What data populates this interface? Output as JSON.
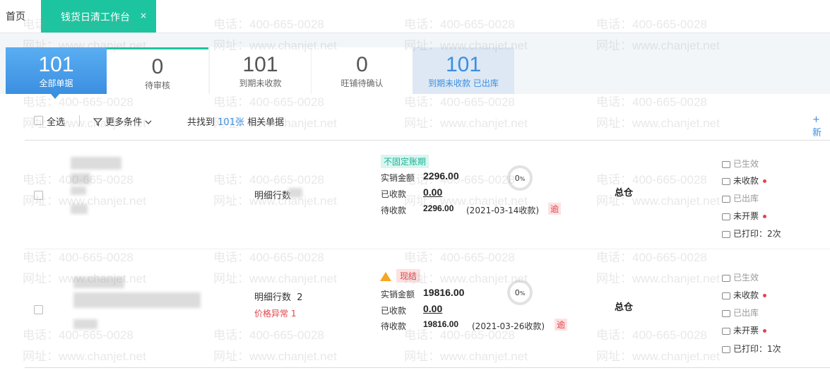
{
  "tabs": {
    "home": "首页",
    "active": "钱货日清工作台",
    "close": "×"
  },
  "stats": [
    {
      "num": "101",
      "label": "全部单据"
    },
    {
      "num": "0",
      "label": "待审核"
    },
    {
      "num": "101",
      "label": "到期未收款"
    },
    {
      "num": "0",
      "label": "旺铺待确认"
    },
    {
      "num": "101",
      "label": "到期未收款 已出库"
    }
  ],
  "toolbar": {
    "select_all": "全选",
    "more_conditions": "更多条件",
    "found_prefix": "共找到",
    "found_count": "101张",
    "found_suffix": "相关单据",
    "new_partial": "+ 新"
  },
  "watermark": {
    "phone": "电话：400-665-0028",
    "site": "网址：www.chanjet.net"
  },
  "rows": [
    {
      "detail": "明细行数",
      "detail_count": "",
      "price_abnormal": "",
      "tag": "不固定账期",
      "sales_label": "实销金额",
      "sales_value": "2296.00",
      "received_label": "已收款",
      "received_value": "0.00",
      "pending_label": "待收款",
      "pending_value": "2296.00",
      "due_date": "(2021-03-14收款)",
      "overdue": "逾",
      "progress_pct": "0",
      "warehouse": "总仓",
      "status": [
        "已生效",
        "未收款",
        "已出库",
        "未开票",
        "已打印：2次"
      ]
    },
    {
      "detail": "明细行数",
      "detail_count": "2",
      "price_abnormal": "价格异常  1",
      "tag": "现结",
      "sales_label": "实销金额",
      "sales_value": "19816.00",
      "received_label": "已收款",
      "received_value": "0.00",
      "pending_label": "待收款",
      "pending_value": "19816.00",
      "due_date": "(2021-03-26收款)",
      "overdue": "逾",
      "progress_pct": "0",
      "warehouse": "总仓",
      "status": [
        "已生效",
        "未收款",
        "已出库",
        "未开票",
        "已打印：1次"
      ]
    }
  ],
  "colors": {
    "accent": "#1cc5a0",
    "blue": "#3b8fe0",
    "red": "#e0464b"
  }
}
